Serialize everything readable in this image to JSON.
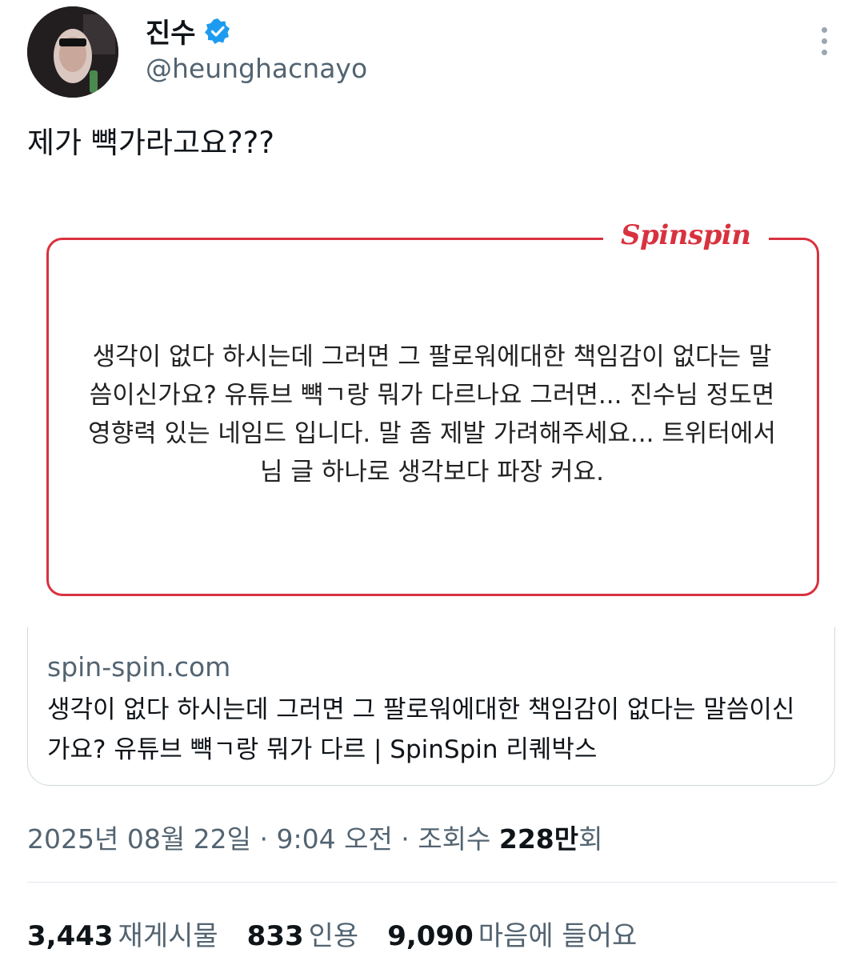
{
  "author": {
    "name": "진수",
    "handle": "@heunghacnayo",
    "verified_color": "#1d9bf0"
  },
  "more_icon": "more-vertical-icon",
  "tweet": {
    "text": "제가 뺵가라고요???"
  },
  "card": {
    "logo_text": "Spinspin",
    "quote": "생각이 없다 하시는데 그러면 그 팔로워에대한 책임감이 없다는 말씀이신가요? 유튜브 뺵ㄱ랑 뭐가 다르나요 그러면... 진수님 정도면 영향력 있는 네임드 입니다. 말 좀 제발 가려해주세요... 트위터에서 님 글 하나로 생각보다 파장 커요.",
    "accent_color": "#d8323f"
  },
  "link": {
    "domain": "spin-spin.com",
    "title": "생각이 없다 하시는데 그러면 그 팔로워에대한 책임감이 없다는 말씀이신가요? 유튜브 뺵ㄱ랑 뭐가 다르 | SpinSpin 리퀘박스"
  },
  "meta": {
    "timestamp": "2025년 08월 22일 · 9:04 오전 · 조회수 ",
    "views_value": "228만",
    "views_suffix": "회"
  },
  "stats": {
    "reposts_count": "3,443",
    "reposts_label": "재게시물",
    "quotes_count": "833",
    "quotes_label": "인용",
    "likes_count": "9,090",
    "likes_label": "마음에 들어요"
  }
}
